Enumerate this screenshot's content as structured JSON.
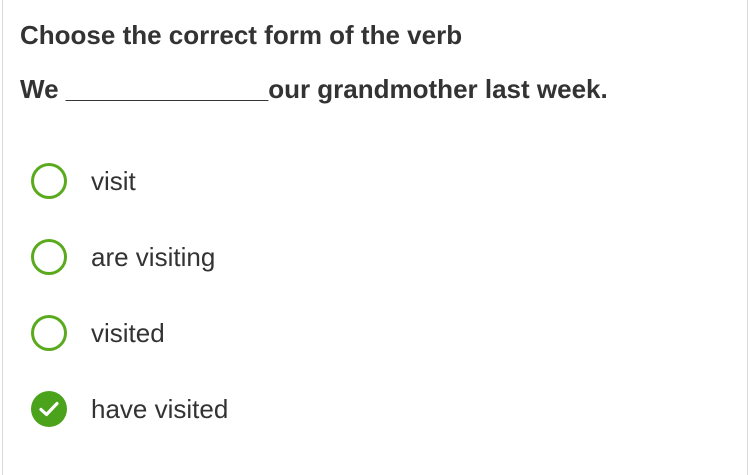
{
  "question": {
    "prompt": "Choose the correct form of the verb",
    "sentence": "We ______________our grandmother last week."
  },
  "options": [
    {
      "label": "visit",
      "selected": false
    },
    {
      "label": "are visiting",
      "selected": false
    },
    {
      "label": "visited",
      "selected": false
    },
    {
      "label": "have visited",
      "selected": true
    }
  ],
  "colors": {
    "accent": "#4aa31a",
    "text": "#333333"
  }
}
